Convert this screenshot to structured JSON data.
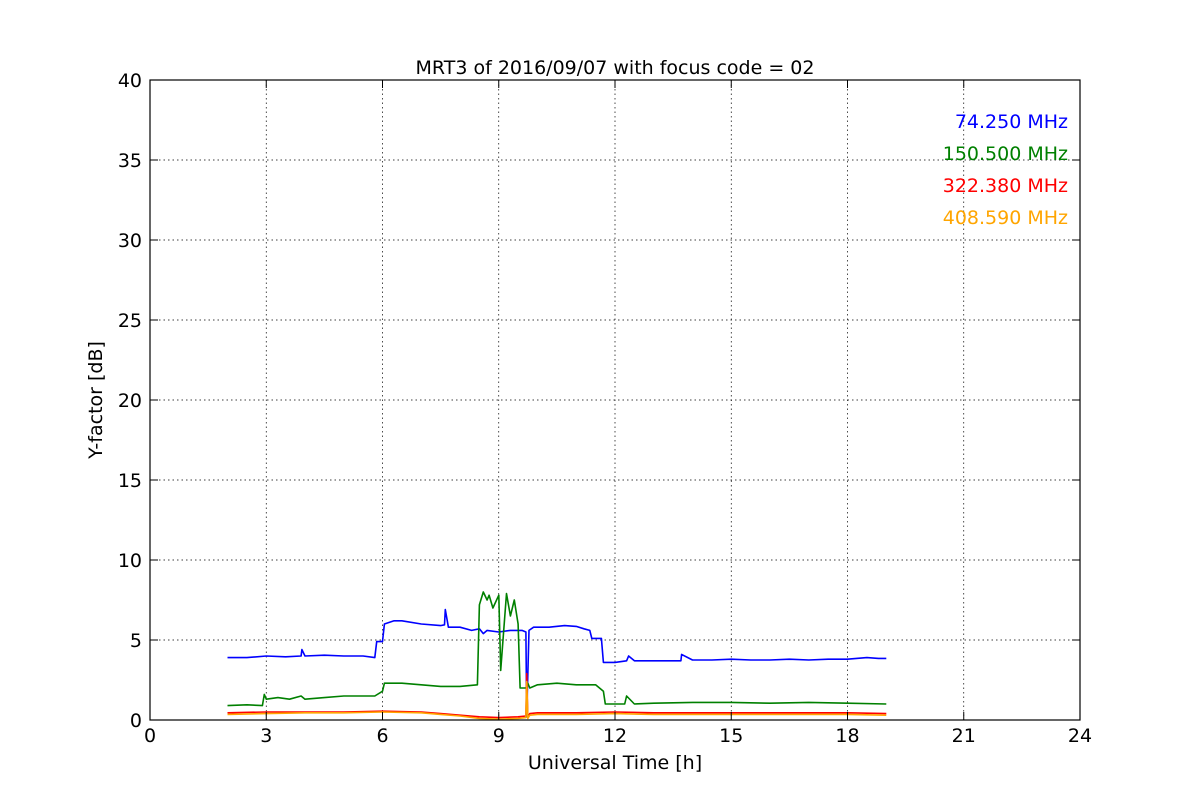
{
  "chart_data": {
    "type": "line",
    "title": "MRT3 of 2016/09/07 with focus code = 02",
    "xlabel": "Universal Time [h]",
    "ylabel": "Y-factor [dB]",
    "xlim": [
      0,
      24
    ],
    "ylim": [
      0,
      40
    ],
    "xticks": [
      0,
      3,
      6,
      9,
      12,
      15,
      18,
      21,
      24
    ],
    "yticks": [
      0,
      5,
      10,
      15,
      20,
      25,
      30,
      35,
      40
    ],
    "xtick_labels": [
      "0",
      "3",
      "6",
      "9",
      "12",
      "15",
      "18",
      "21",
      "24"
    ],
    "ytick_labels": [
      "0",
      "5",
      "10",
      "15",
      "20",
      "25",
      "30",
      "35",
      "40"
    ],
    "grid": true,
    "legend": "top-right",
    "series": [
      {
        "name": "74.250 MHz",
        "color": "#0000ff",
        "x": [
          2.0,
          2.5,
          3.0,
          3.5,
          3.9,
          3.92,
          4.0,
          4.5,
          5.0,
          5.5,
          5.8,
          5.85,
          6.0,
          6.05,
          6.3,
          6.5,
          7.0,
          7.5,
          7.6,
          7.62,
          7.7,
          8.0,
          8.3,
          8.5,
          8.6,
          8.7,
          9.0,
          9.3,
          9.6,
          9.7,
          9.72,
          9.78,
          9.9,
          10.3,
          10.7,
          11.0,
          11.2,
          11.35,
          11.4,
          11.65,
          11.7,
          12.0,
          12.3,
          12.35,
          12.5,
          13.0,
          13.5,
          13.7,
          13.72,
          14.0,
          14.5,
          15.0,
          15.5,
          16.0,
          16.5,
          17.0,
          17.5,
          18.0,
          18.5,
          18.8,
          19.0
        ],
        "values": [
          3.9,
          3.9,
          4.0,
          3.95,
          4.0,
          4.4,
          4.0,
          4.05,
          4.0,
          4.0,
          3.9,
          4.9,
          4.9,
          6.0,
          6.2,
          6.2,
          6.0,
          5.9,
          5.95,
          6.9,
          5.8,
          5.8,
          5.6,
          5.7,
          5.4,
          5.6,
          5.5,
          5.6,
          5.6,
          5.5,
          0.2,
          5.6,
          5.8,
          5.8,
          5.9,
          5.85,
          5.7,
          5.6,
          5.1,
          5.1,
          3.6,
          3.6,
          3.7,
          4.0,
          3.7,
          3.7,
          3.7,
          3.7,
          4.1,
          3.75,
          3.75,
          3.8,
          3.75,
          3.75,
          3.8,
          3.75,
          3.8,
          3.8,
          3.9,
          3.85,
          3.85
        ]
      },
      {
        "name": "150.500 MHz",
        "color": "#008000",
        "x": [
          2.0,
          2.5,
          2.9,
          2.95,
          3.0,
          3.3,
          3.6,
          3.9,
          4.0,
          4.5,
          5.0,
          5.5,
          5.8,
          6.0,
          6.05,
          6.5,
          7.0,
          7.5,
          8.0,
          8.45,
          8.5,
          8.6,
          8.7,
          8.75,
          8.85,
          9.0,
          9.05,
          9.2,
          9.3,
          9.4,
          9.5,
          9.55,
          9.6,
          9.7,
          9.75,
          9.8,
          10.0,
          10.5,
          11.0,
          11.5,
          11.7,
          11.75,
          12.0,
          12.25,
          12.3,
          12.5,
          13.0,
          14.0,
          15.0,
          16.0,
          17.0,
          18.0,
          19.0
        ],
        "values": [
          0.9,
          0.95,
          0.9,
          1.6,
          1.3,
          1.4,
          1.3,
          1.5,
          1.3,
          1.4,
          1.5,
          1.5,
          1.5,
          1.8,
          2.3,
          2.3,
          2.2,
          2.1,
          2.1,
          2.2,
          7.2,
          8.0,
          7.5,
          7.8,
          7.0,
          7.8,
          3.1,
          7.9,
          6.5,
          7.5,
          6.0,
          2.0,
          2.0,
          2.0,
          2.3,
          2.0,
          2.2,
          2.3,
          2.2,
          2.2,
          1.8,
          1.0,
          1.0,
          1.0,
          1.5,
          1.0,
          1.05,
          1.1,
          1.1,
          1.05,
          1.1,
          1.05,
          1.0
        ]
      },
      {
        "name": "322.380 MHz",
        "color": "#ff0000",
        "x": [
          2.0,
          3.0,
          4.0,
          5.0,
          6.0,
          7.0,
          7.5,
          8.0,
          8.5,
          9.0,
          9.5,
          9.7,
          9.72,
          9.75,
          9.8,
          10.0,
          11.0,
          12.0,
          13.0,
          14.0,
          15.0,
          16.0,
          17.0,
          18.0,
          19.0
        ],
        "values": [
          0.45,
          0.5,
          0.5,
          0.5,
          0.55,
          0.5,
          0.4,
          0.3,
          0.2,
          0.15,
          0.2,
          0.25,
          2.9,
          0.2,
          0.4,
          0.45,
          0.45,
          0.5,
          0.45,
          0.45,
          0.45,
          0.45,
          0.45,
          0.45,
          0.4
        ]
      },
      {
        "name": "408.590 MHz",
        "color": "#ffa500",
        "x": [
          2.0,
          3.0,
          4.0,
          5.0,
          6.0,
          7.0,
          7.5,
          8.0,
          8.5,
          9.0,
          9.5,
          9.7,
          9.72,
          9.75,
          9.8,
          10.0,
          11.0,
          12.0,
          13.0,
          14.0,
          15.0,
          16.0,
          17.0,
          18.0,
          19.0
        ],
        "values": [
          0.35,
          0.4,
          0.45,
          0.45,
          0.5,
          0.45,
          0.35,
          0.25,
          0.1,
          0.05,
          0.1,
          0.15,
          2.4,
          0.1,
          0.3,
          0.35,
          0.35,
          0.4,
          0.35,
          0.35,
          0.35,
          0.35,
          0.35,
          0.35,
          0.3
        ]
      }
    ]
  }
}
